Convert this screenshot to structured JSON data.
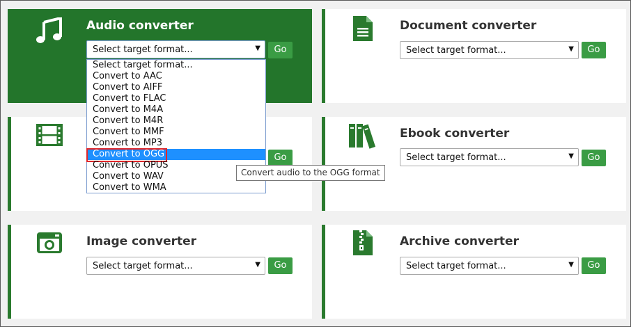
{
  "colors": {
    "accent_green": "#2a7a2e",
    "active_card_bg": "#23752b",
    "button_green": "#3a9c44",
    "highlight_blue": "#1e90ff",
    "highlight_outline": "#e0262b"
  },
  "cards": {
    "audio": {
      "title": "Audio converter",
      "icon": "music-note-icon",
      "select_value": "Select target format...",
      "go_label": "Go"
    },
    "document": {
      "title": "Document converter",
      "icon": "document-icon",
      "select_value": "Select target format...",
      "go_label": "Go"
    },
    "video": {
      "title": "",
      "icon": "film-icon",
      "select_value": "",
      "go_label": "Go"
    },
    "ebook": {
      "title": "Ebook converter",
      "icon": "books-icon",
      "select_value": "Select target format...",
      "go_label": "Go"
    },
    "image": {
      "title": "Image converter",
      "icon": "camera-icon",
      "select_value": "Select target format...",
      "go_label": "Go"
    },
    "archive": {
      "title": "Archive converter",
      "icon": "zip-file-icon",
      "select_value": "Select target format...",
      "go_label": "Go"
    }
  },
  "dropdown": {
    "options": [
      "Select target format...",
      "Convert to AAC",
      "Convert to AIFF",
      "Convert to FLAC",
      "Convert to M4A",
      "Convert to M4R",
      "Convert to MMF",
      "Convert to MP3",
      "Convert to OGG",
      "Convert to OPUS",
      "Convert to WAV",
      "Convert to WMA"
    ],
    "highlighted": "Convert to OGG"
  },
  "tooltip": "Convert audio to the OGG format"
}
